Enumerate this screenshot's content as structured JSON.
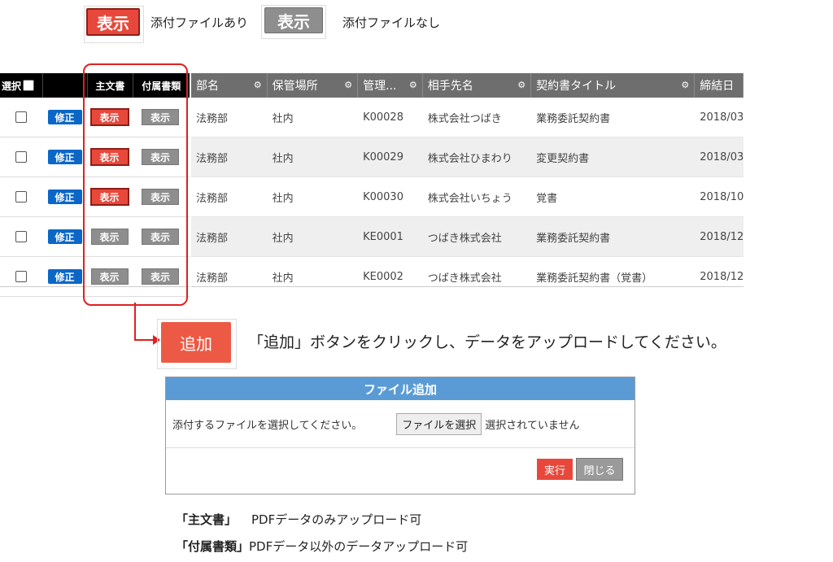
{
  "legend": {
    "show_label": "表示",
    "with_attachment": "添付ファイルあり",
    "without_attachment": "添付ファイルなし"
  },
  "left_table": {
    "headers": {
      "select": "選択",
      "main_doc": "主文書",
      "attached_doc": "付属書類"
    },
    "rows": [
      {
        "edit": "修正",
        "main": "表示",
        "main_has_file": true,
        "attached": "表示",
        "attached_has_file": false
      },
      {
        "edit": "修正",
        "main": "表示",
        "main_has_file": true,
        "attached": "表示",
        "attached_has_file": false
      },
      {
        "edit": "修正",
        "main": "表示",
        "main_has_file": true,
        "attached": "表示",
        "attached_has_file": false
      },
      {
        "edit": "修正",
        "main": "表示",
        "main_has_file": false,
        "attached": "表示",
        "attached_has_file": false
      },
      {
        "edit": "修正",
        "main": "表示",
        "main_has_file": false,
        "attached": "表示",
        "attached_has_file": false
      }
    ]
  },
  "grid": {
    "columns": [
      "部名",
      "保管場所",
      "管理...",
      "相手先名",
      "契約書タイトル",
      "締結日"
    ],
    "rows": [
      [
        "法務部",
        "社内",
        "K00028",
        "株式会社つばき",
        "業務委託契約書",
        "2018/03,"
      ],
      [
        "法務部",
        "社内",
        "K00029",
        "株式会社ひまわり",
        "変更契約書",
        "2018/03,"
      ],
      [
        "法務部",
        "社内",
        "K00030",
        "株式会社いちょう",
        "覚書",
        "2018/10,"
      ],
      [
        "法務部",
        "社内",
        "KE0001",
        "つばき株式会社",
        "業務委託契約書",
        "2018/12,"
      ],
      [
        "法務部",
        "社内",
        "KE0002",
        "つばき株式会社",
        "業務委託契約書（覚書）",
        "2018/12,"
      ]
    ]
  },
  "add_button": {
    "label": "追加"
  },
  "instruction": "「追加」ボタンをクリックし、データをアップロードしてください。",
  "modal": {
    "title": "ファイル追加",
    "prompt": "添付するファイルを選択してください。",
    "choose_file": "ファイルを選択",
    "no_file": "選択されていません",
    "execute": "実行",
    "close": "閉じる"
  },
  "notes": [
    {
      "term": "「主文書」",
      "text": "PDFデータのみアップロード可"
    },
    {
      "term": "「付属書類」",
      "text": "PDFデータ以外のデータアップロード可"
    }
  ],
  "colors": {
    "red": "#e8483b",
    "blue": "#0b67c7",
    "gray": "#8e8e8e",
    "modal_header": "#5b9bd5",
    "highlight": "#e02020"
  }
}
